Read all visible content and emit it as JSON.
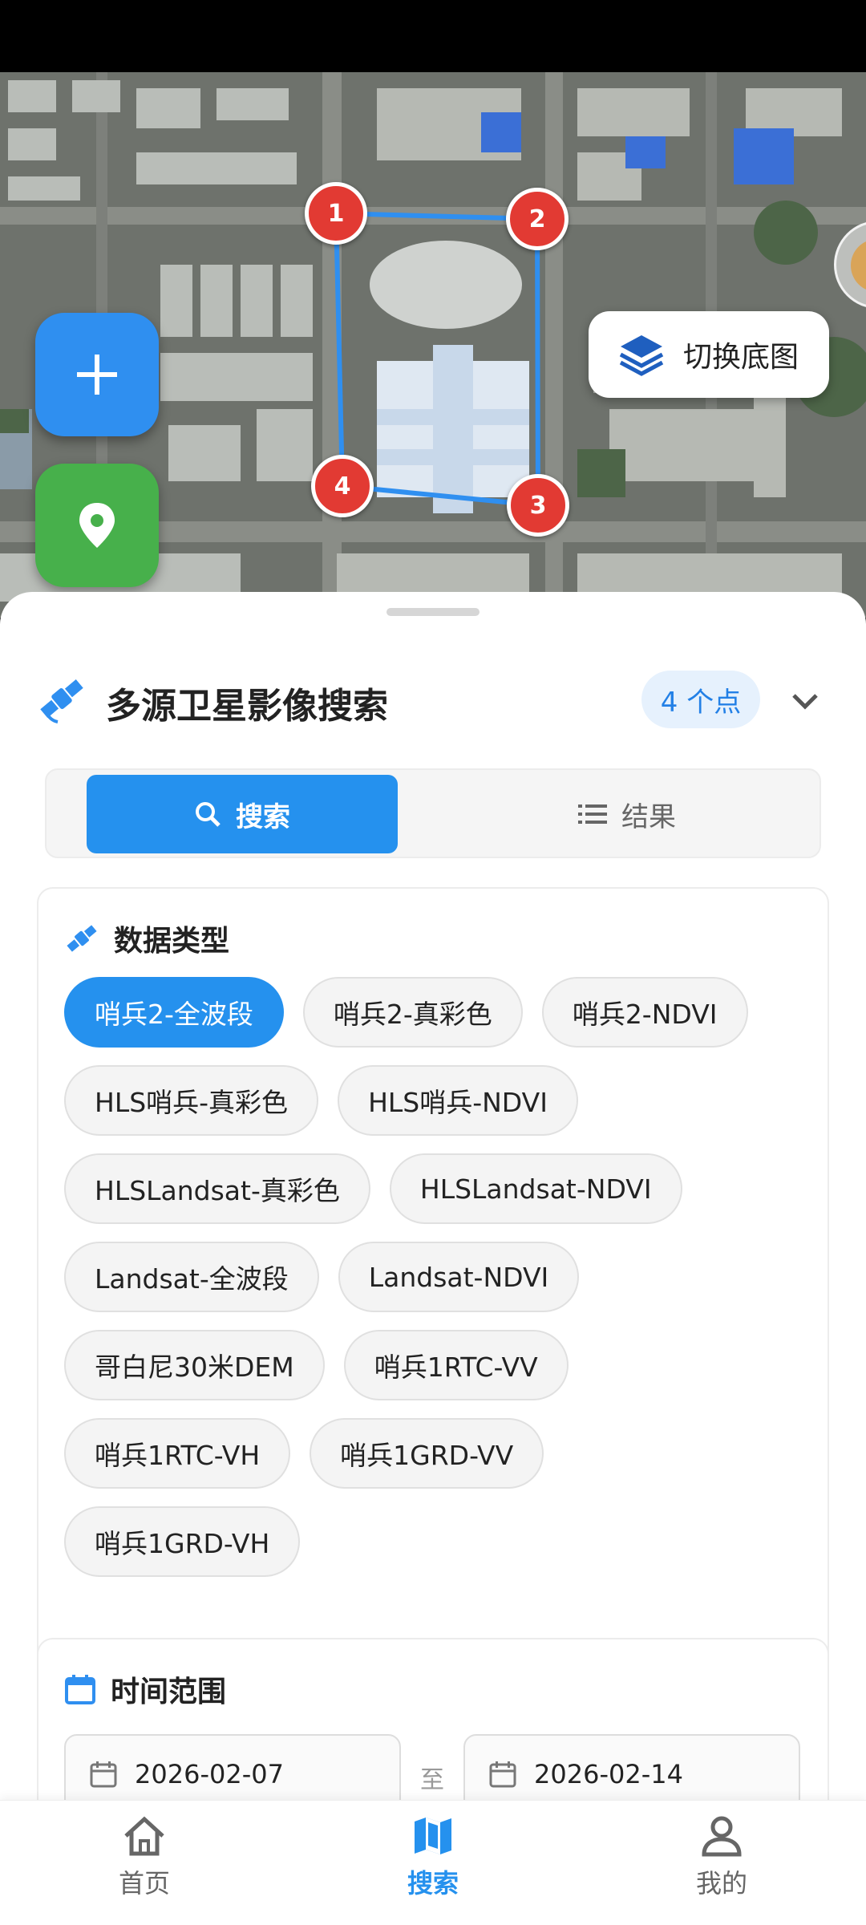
{
  "map": {
    "basemap_button_label": "切换底图",
    "polygon_points": [
      "1",
      "2",
      "3",
      "4"
    ],
    "add_button_icon": "plus-icon",
    "locate_button_icon": "map-pin-icon"
  },
  "panel": {
    "title": "多源卫星影像搜索",
    "point_count": "4 个点",
    "tabs": {
      "search": "搜索",
      "results": "结果"
    }
  },
  "data_type": {
    "title": "数据类型",
    "chip_rows": [
      [
        "哨兵2-全波段",
        "哨兵2-真彩色",
        "哨兵2-NDVI"
      ],
      [
        "HLS哨兵-真彩色",
        "HLS哨兵-NDVI"
      ],
      [
        "HLSLandsat-真彩色",
        "HLSLandsat-NDVI"
      ],
      [
        "Landsat-全波段",
        "Landsat-NDVI"
      ],
      [
        "哥白尼30米DEM",
        "哨兵1RTC-VV"
      ],
      [
        "哨兵1RTC-VH",
        "哨兵1GRD-VV"
      ],
      [
        "哨兵1GRD-VH"
      ]
    ],
    "selected": "哨兵2-全波段"
  },
  "time_range": {
    "title": "时间范围",
    "start": "2026-02-07",
    "separator": "至",
    "end": "2026-02-14"
  },
  "nav": {
    "home": "首页",
    "search": "搜索",
    "mine": "我的",
    "active": "search"
  },
  "colors": {
    "accent": "#2591ee",
    "locate": "#47b04b",
    "vertex": "#e23a33"
  }
}
